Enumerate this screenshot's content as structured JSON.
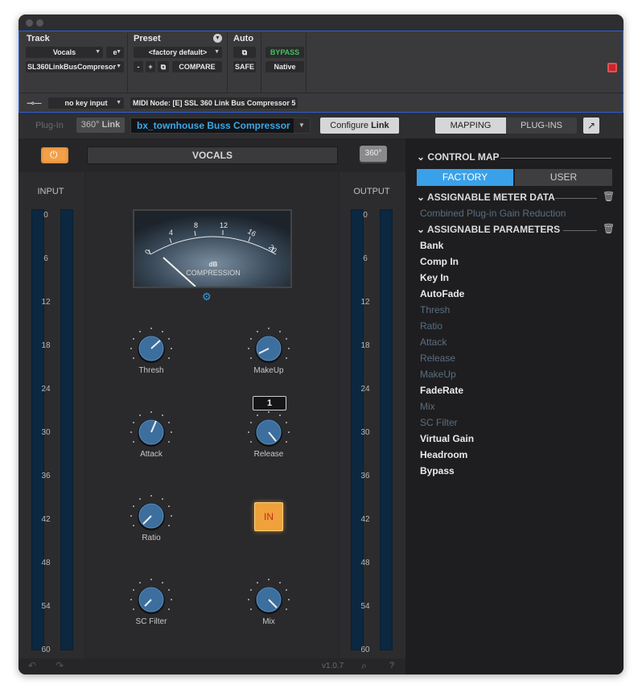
{
  "pt": {
    "track_label": "Track",
    "preset_label": "Preset",
    "auto_label": "Auto",
    "track_name": "Vocals",
    "track_suffix": "e",
    "insert_name": "SL360LinkBusCompresor",
    "preset_value": "<factory default>",
    "minus": "-",
    "plus": "+",
    "compare": "COMPARE",
    "safe": "SAFE",
    "bypass": "BYPASS",
    "native": "Native",
    "key_input": "no key input",
    "midi_node": "MIDI Node: [E] SSL 360 Link Bus Compressor 5"
  },
  "plugin": {
    "plugin_label": "Plug-In",
    "link_badge_a": "360°",
    "link_badge_b": "Link",
    "plugin_select": "bx_townhouse Buss Compressor",
    "configure_a": "Configure",
    "configure_b": "Link",
    "channel_name": "VOCALS",
    "btn_360": "360°",
    "input_label": "INPUT",
    "output_label": "OUTPUT",
    "scale": [
      "0",
      "6",
      "12",
      "18",
      "24",
      "30",
      "36",
      "42",
      "48",
      "54",
      "60"
    ],
    "vu": {
      "ticks": [
        "0",
        "4",
        "8",
        "12",
        "16",
        "20"
      ],
      "unit": "dB",
      "caption": "COMPRESSION"
    },
    "knobs": {
      "thresh": "Thresh",
      "makeup": "MakeUp",
      "attack": "Attack",
      "release": "Release",
      "ratio": "Ratio",
      "sc_filter": "SC Filter",
      "mix": "Mix"
    },
    "release_value": "1",
    "in_button": "IN",
    "version": "v1.0.7",
    "help": "?"
  },
  "right": {
    "tab_mapping": "MAPPING",
    "tab_plugins": "PLUG-INS",
    "control_map": "CONTROL MAP",
    "factory": "FACTORY",
    "user": "USER",
    "meter_head": "ASSIGNABLE METER DATA",
    "meter_item": "Combined Plug-in Gain Reduction",
    "params_head": "ASSIGNABLE PARAMETERS",
    "params": [
      {
        "label": "Bank",
        "active": true
      },
      {
        "label": "Comp In",
        "active": true
      },
      {
        "label": "Key In",
        "active": true
      },
      {
        "label": "AutoFade",
        "active": true
      },
      {
        "label": "Thresh",
        "active": false
      },
      {
        "label": "Ratio",
        "active": false
      },
      {
        "label": "Attack",
        "active": false
      },
      {
        "label": "Release",
        "active": false
      },
      {
        "label": "MakeUp",
        "active": false
      },
      {
        "label": "FadeRate",
        "active": true
      },
      {
        "label": "Mix",
        "active": false
      },
      {
        "label": "SC Filter",
        "active": false
      },
      {
        "label": "Virtual Gain",
        "active": true
      },
      {
        "label": "Headroom",
        "active": true
      },
      {
        "label": "Bypass",
        "active": true
      }
    ]
  },
  "colors": {
    "accent_blue": "#3a9bd9",
    "knob_blue": "#3c6e9e",
    "bypass_green": "#42c25a",
    "in_orange": "#f0a23a"
  }
}
